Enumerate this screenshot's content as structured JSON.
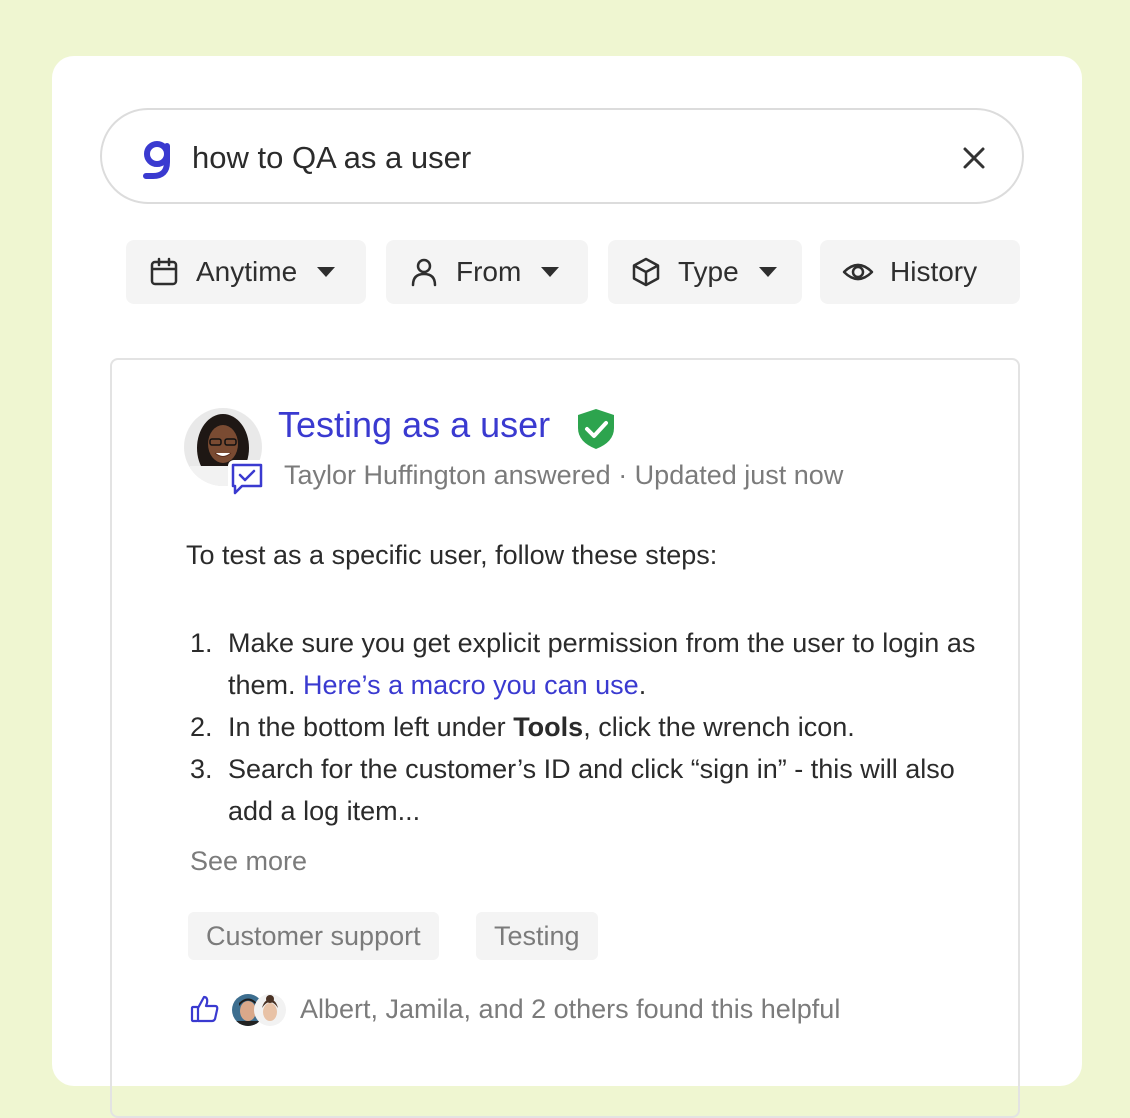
{
  "search": {
    "query": "how to QA as a user",
    "logo_icon": "glean-g-logo",
    "clear_icon": "close-icon"
  },
  "filters": [
    {
      "label": "Anytime",
      "icon": "calendar-icon",
      "has_dropdown": true
    },
    {
      "label": "From",
      "icon": "person-icon",
      "has_dropdown": true
    },
    {
      "label": "Type",
      "icon": "cube-icon",
      "has_dropdown": true
    },
    {
      "label": "History",
      "icon": "eye-icon",
      "has_dropdown": false
    }
  ],
  "result": {
    "title": "Testing as a user",
    "verified_icon": "verified-shield-icon",
    "meta": "Taylor Huffington answered · Updated just now",
    "intro": "To test as a specific user, follow these steps:",
    "steps": [
      {
        "num": "1.",
        "text": "Make sure you get explicit permission from the user to login as them. ",
        "link": "Here’s a macro you can use",
        "after": "."
      },
      {
        "num": "2.",
        "before": "In the bottom left under ",
        "bold": "Tools",
        "after": ", click the wrench icon."
      },
      {
        "num": "3.",
        "text": "Search for the customer’s ID and click “sign in” - this will also add a log item..."
      }
    ],
    "see_more": "See more",
    "tags": [
      "Customer support",
      "Testing"
    ],
    "helpful_text": "Albert, Jamila, and 2 others found this helpful"
  },
  "colors": {
    "background": "#eff6d1",
    "accent": "#3a3ad0",
    "verified": "#2da44e",
    "muted_text": "#7b7b7b"
  }
}
